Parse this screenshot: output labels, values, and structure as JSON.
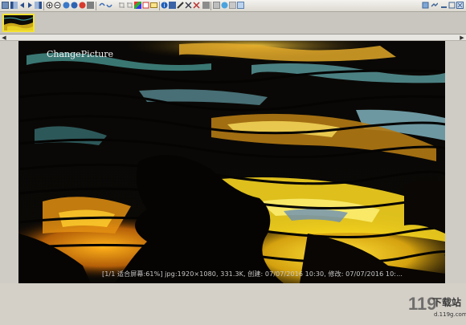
{
  "toolbar": {
    "icons": [
      "grid-icon",
      "first-icon",
      "prev-icon",
      "next-icon",
      "last-icon",
      "zoom-in-icon",
      "zoom-out-icon",
      "rotate-left-icon",
      "rotate-right-icon",
      "fit-icon",
      "copy-icon",
      "undo-icon",
      "redo-icon",
      "crop-icon",
      "color-icon",
      "info-icon",
      "slideshow-icon",
      "edit-icon",
      "delete-icon",
      "settings-icon",
      "help-icon"
    ],
    "right_icons": [
      "download-icon",
      "pin-icon",
      "minimize-icon",
      "maximize-icon",
      "close-icon"
    ]
  },
  "thumbnail": {
    "selected": true,
    "border_color": "#f3e234"
  },
  "viewer": {
    "caption": "ChangePicture",
    "status": "[1/1 适合屏幕:61%] jpg:1920×1080, 331.3K, 创建: 07/07/2016 10:30, 修改: 07/07/2016 10:..."
  },
  "watermark": {
    "brand": "下载站",
    "site": "d.119g.com"
  }
}
